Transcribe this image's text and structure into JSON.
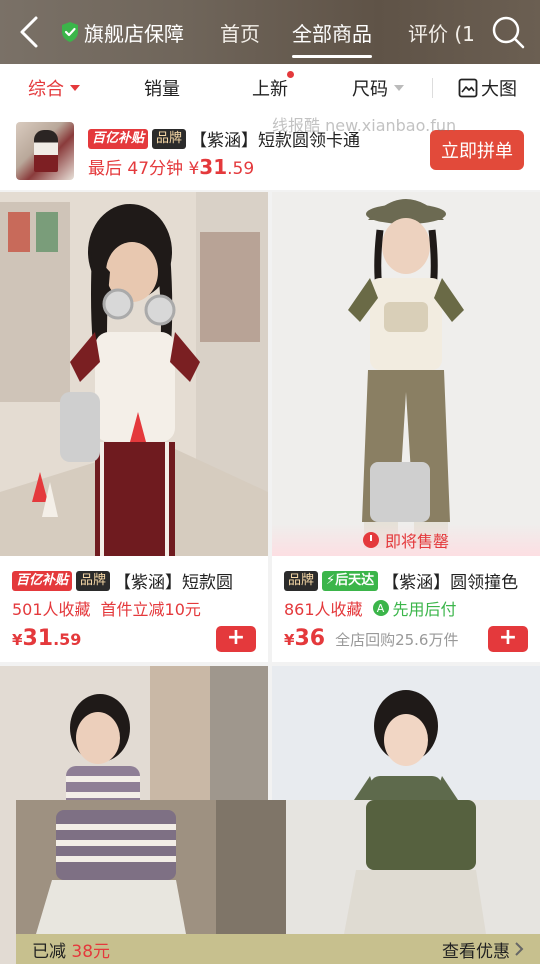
{
  "header": {
    "store_guarantee": "旗舰店保障",
    "tabs": [
      {
        "label": "首页",
        "active": false
      },
      {
        "label": "全部商品",
        "active": true
      },
      {
        "label": "评价 (1",
        "active": false
      }
    ]
  },
  "filters": {
    "items": [
      {
        "label": "综合",
        "active": true
      },
      {
        "label": "销量",
        "active": false
      },
      {
        "label": "上新",
        "active": false
      },
      {
        "label": "尺码",
        "active": false
      },
      {
        "label": "大图",
        "active": false
      }
    ]
  },
  "promo": {
    "badge_subsidy": "百亿补贴",
    "badge_brand": "品牌",
    "title": "【紫涵】短款圆领卡通",
    "countdown_prefix": "最后",
    "countdown": "47分钟",
    "price_symbol": "¥",
    "price_int": "31",
    "price_dec": ".59",
    "button": "立即拼单"
  },
  "watermark": "线报酷 new.xianbao.fun",
  "products": [
    {
      "badge_subsidy": "百亿补贴",
      "badge_brand": "品牌",
      "title": "【紫涵】短款圆",
      "favorites": "501人收藏",
      "promo": "首件立减10元",
      "price_symbol": "¥",
      "price_int": "31",
      "price_dec": ".59",
      "extra": "",
      "add_label": "+"
    },
    {
      "badge_brand": "品牌",
      "badge_delivery": "后天达",
      "title": "【紫涵】圆领撞色",
      "favorites": "861人收藏",
      "promo": "先用后付",
      "price_symbol": "¥",
      "price_int": "36",
      "price_dec": "",
      "extra": "全店回购25.6万件",
      "add_label": "+",
      "soon_label": "即将售罄"
    }
  ],
  "coupon_bar": {
    "left_prefix": "已减",
    "amount": "38元",
    "right": "查看优惠"
  },
  "colors": {
    "accent": "#e4393c",
    "promo_button": "#e24a3a",
    "brand_badge_bg": "#2b2b2b",
    "delivery_badge_bg": "#3bb54a",
    "coupon_bar_bg": "#c7c08e"
  }
}
